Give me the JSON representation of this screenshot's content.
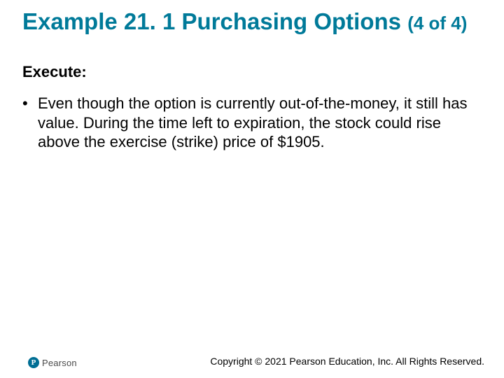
{
  "title": {
    "main": "Example 21. 1 Purchasing Options",
    "suffix": "(4 of 4)"
  },
  "section_label": "Execute:",
  "bullets": [
    "Even though the option is currently out-of-the-money, it still has value. During the time left to expiration, the stock could rise above the exercise (strike) price of $1905."
  ],
  "footer": {
    "brand": "Pearson",
    "copyright": "Copyright © 2021 Pearson Education, Inc. All Rights Reserved."
  }
}
